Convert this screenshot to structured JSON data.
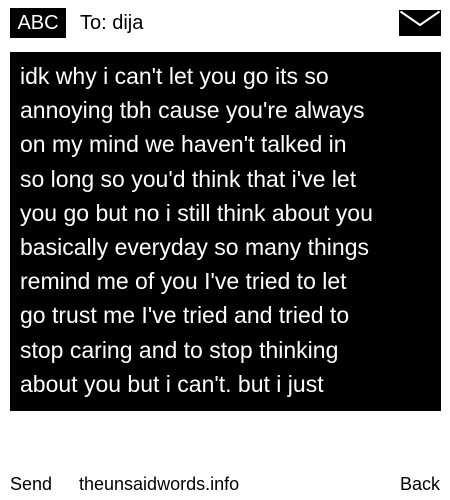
{
  "header": {
    "mode": "ABC",
    "recipient": "To: dija",
    "icon": "envelope-icon"
  },
  "message": {
    "body": "idk why i can't let you go its so\nannoying tbh cause you're always\non my mind we haven't talked in\nso long so you'd think that i've let\nyou go but no i still think about you\nbasically everyday so many things\nremind me of you I've tried to let\ngo trust me I've tried and tried to\nstop caring and to stop thinking\nabout you but i can't. but i just"
  },
  "footer": {
    "send_label": "Send",
    "site": "theunsaidwords.info",
    "back_label": "Back"
  },
  "colors": {
    "background": "#ffffff",
    "message_box": "#000000",
    "message_text": "#ffffff"
  }
}
